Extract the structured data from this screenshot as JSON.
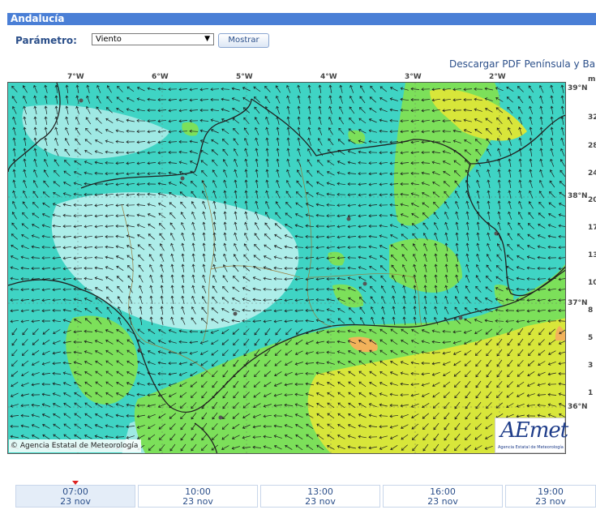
{
  "header": {
    "title": "Andalucía"
  },
  "controls": {
    "parameter_label": "Parámetro:",
    "parameter_value": "Viento",
    "show_button": "Mostrar"
  },
  "download_link": "Descargar PDF Península y Bale",
  "map": {
    "longitude_labels": [
      "7°W",
      "6°W",
      "5°W",
      "4°W",
      "3°W",
      "2°W"
    ],
    "latitude_labels": [
      "39°N",
      "38°N",
      "37°N",
      "36°N"
    ],
    "legend_values": [
      "m",
      "32",
      "28",
      "24",
      "20",
      "17",
      "13",
      "10",
      "8",
      "5",
      "3",
      "1"
    ],
    "copyright": "© Agencia Estatal de Meteorología",
    "logo_text": "AEmet",
    "logo_subtitle": "Agencia Estatal de Meteorología",
    "colors": {
      "sea_cyan": "#3fd4c4",
      "pale": "#c9f2f2",
      "green": "#7ce05a",
      "yellow": "#d8e63a",
      "orange": "#f2b25a",
      "border": "#222222",
      "province": "#9a7a3a"
    }
  },
  "timeline": [
    {
      "time": "07:00",
      "date": "23 nov"
    },
    {
      "time": "10:00",
      "date": "23 nov"
    },
    {
      "time": "13:00",
      "date": "23 nov"
    },
    {
      "time": "16:00",
      "date": "23 nov"
    },
    {
      "time": "19:00",
      "date": "23 nov"
    }
  ]
}
